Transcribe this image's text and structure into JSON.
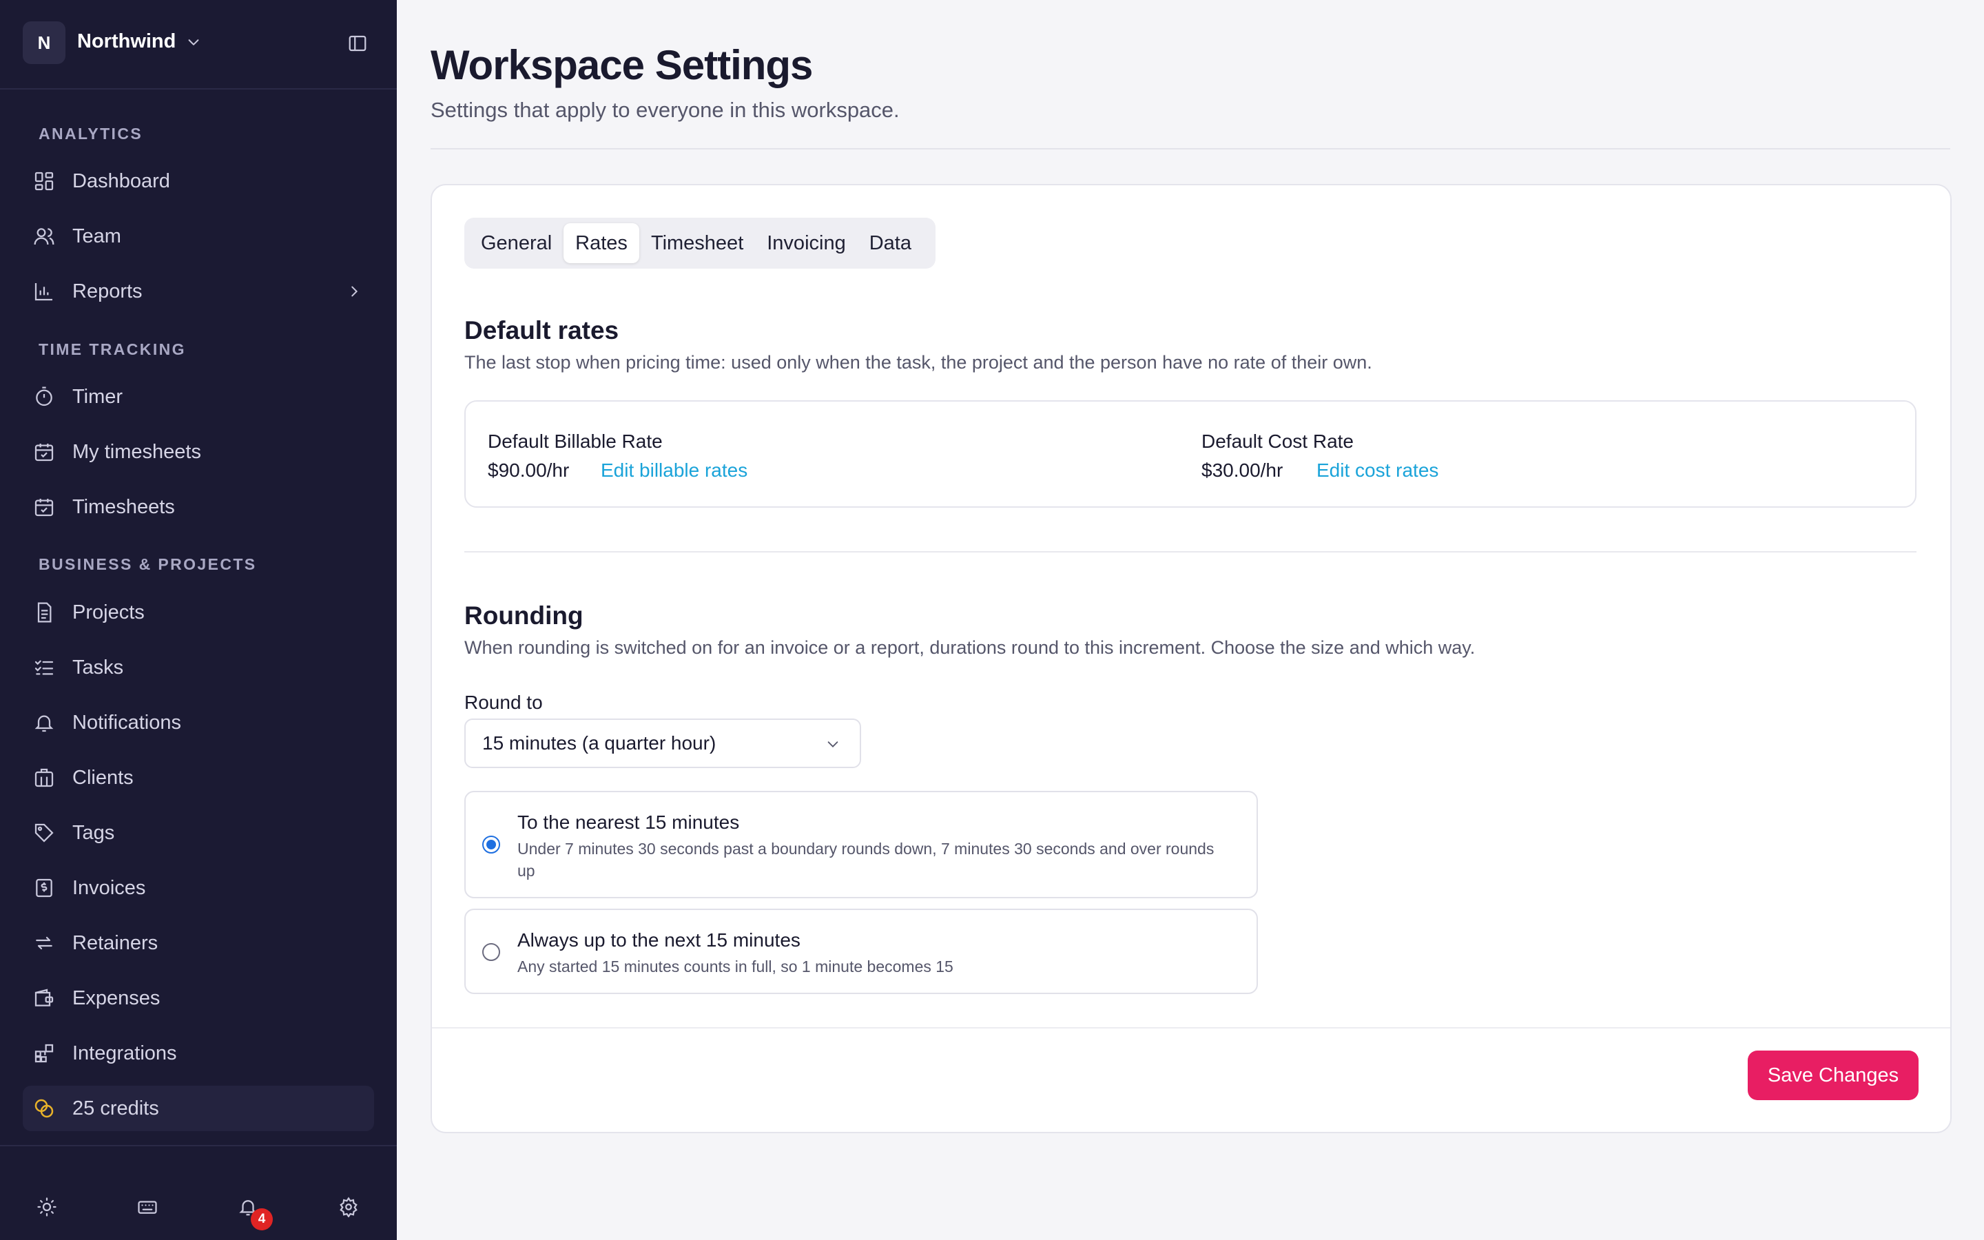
{
  "workspace": {
    "initial": "N",
    "name": "Northwind"
  },
  "sidebar": {
    "sections": [
      {
        "label": "ANALYTICS"
      },
      {
        "label": "TIME TRACKING"
      },
      {
        "label": "BUSINESS & PROJECTS"
      }
    ],
    "items": [
      {
        "label": "Dashboard",
        "icon": "dashboard-icon"
      },
      {
        "label": "Team",
        "icon": "team-icon"
      },
      {
        "label": "Reports",
        "icon": "reports-icon"
      },
      {
        "label": "Timer",
        "icon": "timer-icon"
      },
      {
        "label": "My timesheets",
        "icon": "calendar-check-icon"
      },
      {
        "label": "Timesheets",
        "icon": "calendar-check-icon"
      },
      {
        "label": "Projects",
        "icon": "document-icon"
      },
      {
        "label": "Tasks",
        "icon": "checklist-icon"
      },
      {
        "label": "Notifications",
        "icon": "bell-icon"
      },
      {
        "label": "Clients",
        "icon": "building-icon"
      },
      {
        "label": "Tags",
        "icon": "tag-icon"
      },
      {
        "label": "Invoices",
        "icon": "invoice-icon"
      },
      {
        "label": "Retainers",
        "icon": "repeat-icon"
      },
      {
        "label": "Expenses",
        "icon": "wallet-icon"
      },
      {
        "label": "Integrations",
        "icon": "integrations-icon"
      },
      {
        "label": "25 credits",
        "icon": "coins-icon"
      }
    ],
    "footer": {
      "notification_count": "4"
    }
  },
  "page": {
    "title": "Workspace Settings",
    "subtitle": "Settings that apply to everyone in this workspace."
  },
  "tabs": [
    "General",
    "Rates",
    "Timesheet",
    "Invoicing",
    "Data"
  ],
  "active_tab": "Rates",
  "default_rates": {
    "title": "Default rates",
    "description": "The last stop when pricing time: used only when the task, the project and the person have no rate of their own.",
    "billable_label": "Default Billable Rate",
    "billable_value": "$90.00/hr",
    "billable_link": "Edit billable rates",
    "cost_label": "Default Cost Rate",
    "cost_value": "$30.00/hr",
    "cost_link": "Edit cost rates"
  },
  "rounding": {
    "title": "Rounding",
    "description": "When rounding is switched on for an invoice or a report, durations round to this increment. Choose the size and which way.",
    "field_label": "Round to",
    "selected": "15 minutes (a quarter hour)",
    "options": [
      {
        "title": "To the nearest 15 minutes",
        "desc": "Under 7 minutes 30 seconds past a boundary rounds down, 7 minutes 30 seconds and over rounds up",
        "checked": true
      },
      {
        "title": "Always up to the next 15 minutes",
        "desc": "Any started 15 minutes counts in full, so 1 minute becomes 15",
        "checked": false
      }
    ]
  },
  "save_label": "Save Changes",
  "colors": {
    "sidebar": "#1b1a33",
    "accent": "#e81e63",
    "link": "#1aa3d9",
    "radio": "#1e6fe0"
  }
}
